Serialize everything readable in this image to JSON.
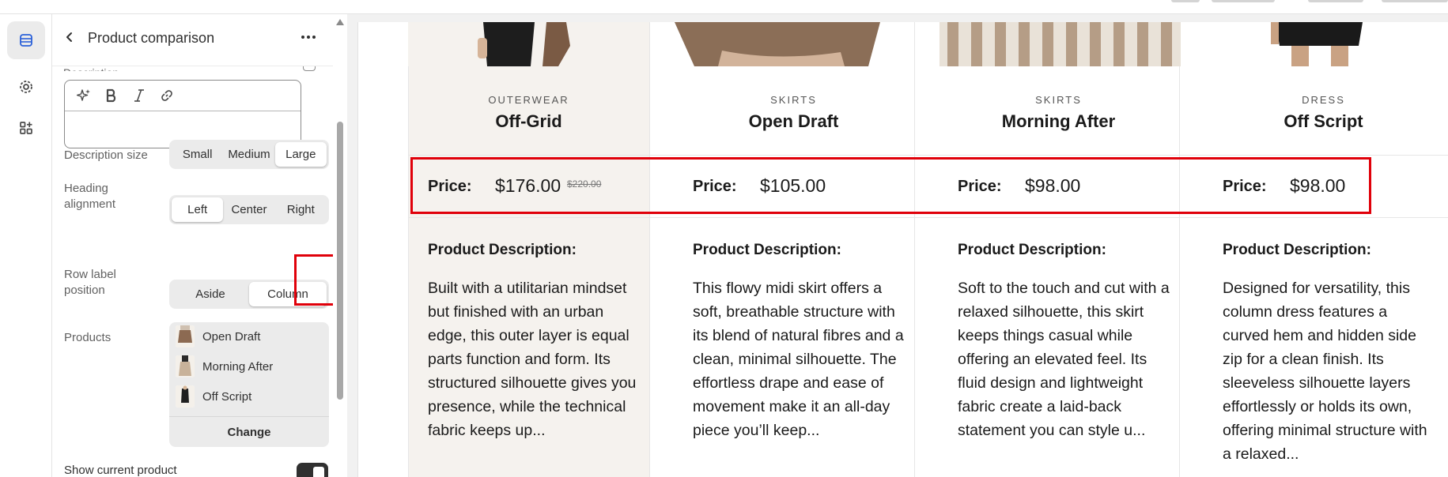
{
  "sidebar": {
    "title": "Product comparison",
    "peek_label": "Description"
  },
  "editor": {
    "tools": [
      "sparkle-icon",
      "bold-icon",
      "italic-icon",
      "link-icon"
    ]
  },
  "settings": {
    "description_size": {
      "label": "Description size",
      "options": [
        "Small",
        "Medium",
        "Large"
      ],
      "selected": "Large"
    },
    "heading_alignment": {
      "label": "Heading alignment",
      "options": [
        "Left",
        "Center",
        "Right"
      ],
      "selected": "Left"
    },
    "row_label_position": {
      "label": "Row label position",
      "options": [
        "Aside",
        "Column"
      ],
      "selected": "Column"
    },
    "products": {
      "label": "Products",
      "items": [
        "Open Draft",
        "Morning After",
        "Off Script"
      ],
      "change_label": "Change"
    },
    "show_current_product": {
      "label": "Show current product",
      "enabled": true
    }
  },
  "preview": {
    "price_label": "Price:",
    "description_label": "Product Description:",
    "products": [
      {
        "category": "OUTERWEAR",
        "name": "Off-Grid",
        "price": "$176.00",
        "compare_at": "$220.00",
        "description": "Built with a utilitarian mindset but finished with an urban edge, this outer layer is equal parts function and form. Its structured silhouette gives you presence, while the technical fabric keeps up..."
      },
      {
        "category": "SKIRTS",
        "name": "Open Draft",
        "price": "$105.00",
        "compare_at": "",
        "description": "This flowy midi skirt offers a soft, breathable structure with its blend of natural fibres and a clean, minimal silhouette. The effortless drape and ease of movement make it an all-day piece you’ll keep..."
      },
      {
        "category": "SKIRTS",
        "name": "Morning After",
        "price": "$98.00",
        "compare_at": "",
        "description": "Soft to the touch and cut with a relaxed silhouette, this skirt keeps things casual while offering an elevated feel. Its fluid design and lightweight fabric create a laid-back statement you can style u..."
      },
      {
        "category": "DRESS",
        "name": "Off Script",
        "price": "$98.00",
        "compare_at": "",
        "description": "Designed for versatility, this column dress features a curved hem and hidden side zip for a clean finish. Its sleeveless silhouette layers effortlessly or holds its own, offering minimal structure with a relaxed..."
      }
    ]
  },
  "colors": {
    "highlight": "#e0000a",
    "first_column_bg": "#f5f2ee",
    "toggle_on": "#303030"
  }
}
